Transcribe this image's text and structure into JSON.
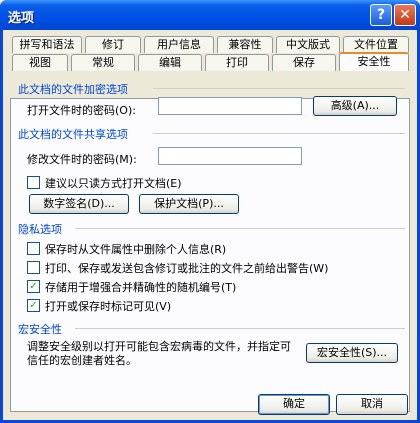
{
  "window": {
    "title": "选项",
    "help_glyph": "?",
    "close_glyph": "✕"
  },
  "tabs_row1": [
    {
      "label": "拼写和语法"
    },
    {
      "label": "修订"
    },
    {
      "label": "用户信息"
    },
    {
      "label": "兼容性"
    },
    {
      "label": "中文版式"
    },
    {
      "label": "文件位置"
    }
  ],
  "tabs_row2": [
    {
      "label": "视图"
    },
    {
      "label": "常规"
    },
    {
      "label": "编辑"
    },
    {
      "label": "打印"
    },
    {
      "label": "保存"
    },
    {
      "label": "安全性",
      "active": true
    }
  ],
  "encryption": {
    "section_title": "此文档的文件加密选项",
    "open_password_label": "打开文件时的密码(O):",
    "open_password_value": "",
    "advanced_button": "高级(A)..."
  },
  "sharing": {
    "section_title": "此文档的文件共享选项",
    "modify_password_label": "修改文件时的密码(M):",
    "modify_password_value": "",
    "readonly_recommended_label": "建议以只读方式打开文档(E)",
    "readonly_recommended_checked": false,
    "digital_signature_button": "数字签名(D)...",
    "protect_document_button": "保护文档(P)..."
  },
  "privacy": {
    "section_title": "隐私选项",
    "options": [
      {
        "label": "保存时从文件属性中删除个人信息(R)",
        "checked": false
      },
      {
        "label": "打印、保存或发送包含修订或批注的文件之前给出警告(W)",
        "checked": false
      },
      {
        "label": "存储用于增强合并精确性的随机编号(T)",
        "checked": true
      },
      {
        "label": "打开或保存时标记可见(V)",
        "checked": true
      }
    ]
  },
  "macro": {
    "section_title": "宏安全性",
    "description": "调整安全级别以打开可能包含宏病毒的文件，并指定可信任的宏创建者姓名。",
    "button": "宏安全性(S)..."
  },
  "footer": {
    "ok_button": "确定",
    "cancel_button": "取消"
  },
  "colors": {
    "section_title": "#0046d5",
    "titlebar": "#0050e6",
    "face": "#ece9d8"
  }
}
